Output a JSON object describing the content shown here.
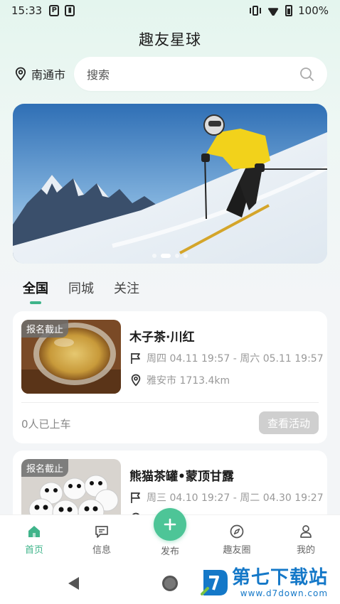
{
  "status_bar": {
    "time": "15:33",
    "icon_p": "P",
    "battery": "100%"
  },
  "header": {
    "title": "趣友星球"
  },
  "location": {
    "city": "南通市"
  },
  "search": {
    "placeholder": "搜索"
  },
  "banner": {
    "slides": 4,
    "active_slide": 2
  },
  "tabs": [
    {
      "label": "全国",
      "active": true
    },
    {
      "label": "同城",
      "active": false
    },
    {
      "label": "关注",
      "active": false
    }
  ],
  "events": [
    {
      "badge": "报名截止",
      "title": "木子茶·川红",
      "date_range": "周四 04.11 19:57 - 周六 05.11 19:57",
      "location": "雅安市 1713.4km",
      "passengers": "0人已上车",
      "button": "查看活动"
    },
    {
      "badge": "报名截止",
      "title": "熊猫茶罐•蒙顶甘露",
      "date_range": "周三 04.10 19:27 - 周二 04.30 19:27"
    }
  ],
  "bottom_nav": [
    {
      "label": "首页",
      "icon": "home-icon",
      "active": true
    },
    {
      "label": "信息",
      "icon": "message-icon",
      "active": false
    },
    {
      "label": "发布",
      "icon": "plus-icon",
      "active": false
    },
    {
      "label": "趣友圈",
      "icon": "compass-icon",
      "active": false
    },
    {
      "label": "我的",
      "icon": "user-icon",
      "active": false
    }
  ],
  "watermark": {
    "name": "第七下载站",
    "url": "www.d7down.com"
  },
  "colors": {
    "accent": "#3fb48a",
    "fab": "#4dc597",
    "button_disabled": "#cfcfcf"
  }
}
